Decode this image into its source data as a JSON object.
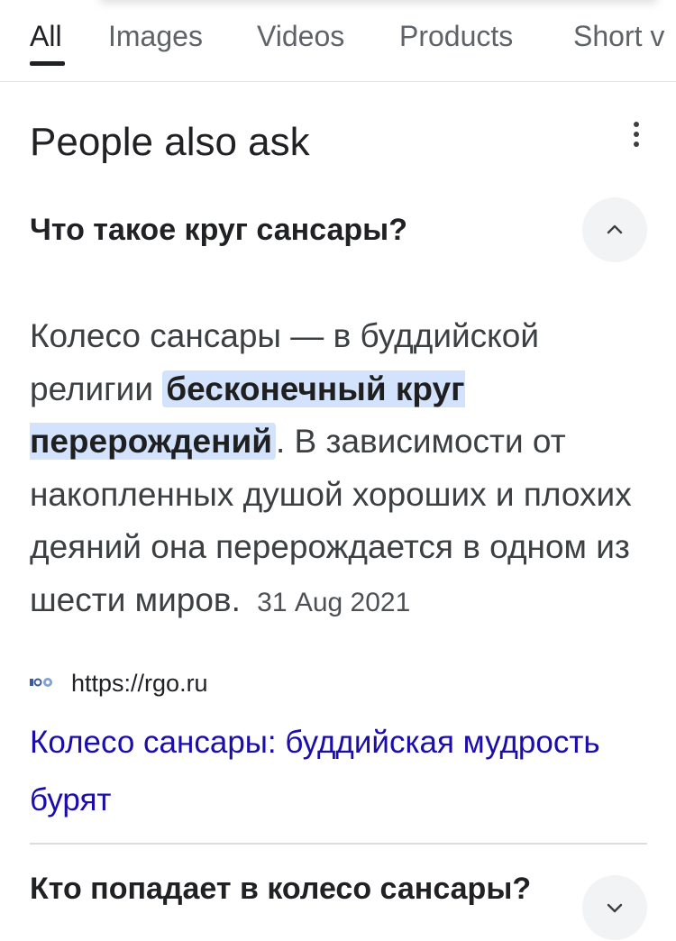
{
  "tabs": [
    {
      "label": "All",
      "active": true
    },
    {
      "label": "Images",
      "active": false
    },
    {
      "label": "Videos",
      "active": false
    },
    {
      "label": "Products",
      "active": false
    },
    {
      "label": "Short v",
      "active": false
    }
  ],
  "paa": {
    "title": "People also ask",
    "more_icon": "more-vert-icon",
    "questions": [
      {
        "text": "Что такое круг сансары?",
        "expanded": true,
        "toggle_icon": "chevron-up-icon"
      },
      {
        "text": "Кто попадает в колесо сансары?",
        "expanded": false,
        "toggle_icon": "chevron-down-icon"
      }
    ],
    "answer": {
      "text_before": "Колесо сансары — в буддийской религии ",
      "highlight": "бесконечный круг перерождений",
      "text_after": ". В зависимости от накопленных душой хороших и плохих деяний она перерождается в одном из шести миров.",
      "date": "31 Aug 2021"
    },
    "source": {
      "favicon": "site-favicon-icon",
      "url": "https://rgo.ru",
      "link_title": "Колесо сансары: буддийская мудрость бурят"
    }
  },
  "colors": {
    "link": "#1a0dab",
    "highlight_bg": "#d3e3fd",
    "chevron_bg": "#f1f3f4",
    "text": "#202124"
  }
}
